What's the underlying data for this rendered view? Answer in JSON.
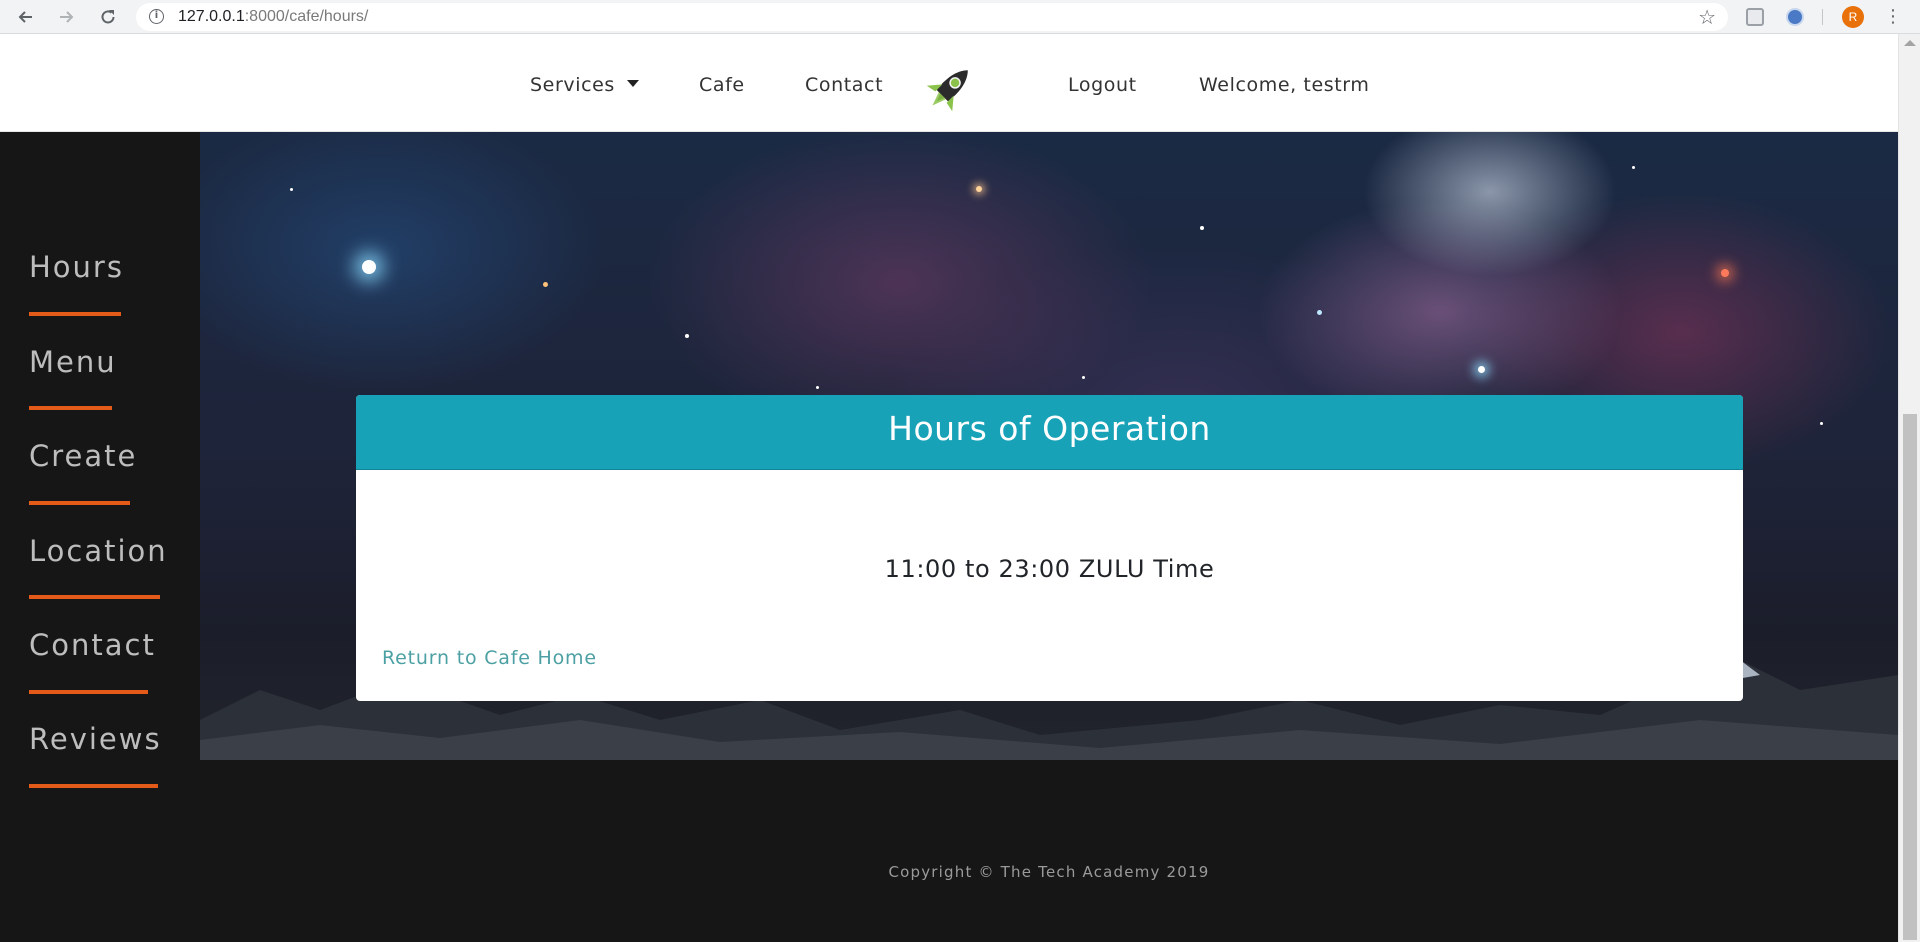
{
  "browser": {
    "url_host": "127.0.0.1",
    "url_path": ":8000/cafe/hours/",
    "profile_initial": "R",
    "icons": [
      "back-icon",
      "forward-icon",
      "reload-icon",
      "site-info-icon",
      "bookmark-star-icon",
      "extension-icon",
      "extension-icon",
      "kebab-menu-icon"
    ]
  },
  "nav": {
    "services": "Services",
    "cafe": "Cafe",
    "contact": "Contact",
    "logout": "Logout",
    "welcome": "Welcome, testrm"
  },
  "sidebar": {
    "items": [
      {
        "label": "Hours"
      },
      {
        "label": "Menu"
      },
      {
        "label": "Create"
      },
      {
        "label": "Location"
      },
      {
        "label": "Contact"
      },
      {
        "label": "Reviews"
      }
    ]
  },
  "card": {
    "title": "Hours of Operation",
    "hours": "11:00 to 23:00 ZULU Time",
    "link": "Return to Cafe Home"
  },
  "footer": {
    "copyright": "Copyright © The Tech Academy 2019"
  },
  "colors": {
    "accent": "#17a2b8",
    "underline": "#e35a19",
    "link": "#4ca0a4",
    "sidebar_bg": "#161616"
  }
}
